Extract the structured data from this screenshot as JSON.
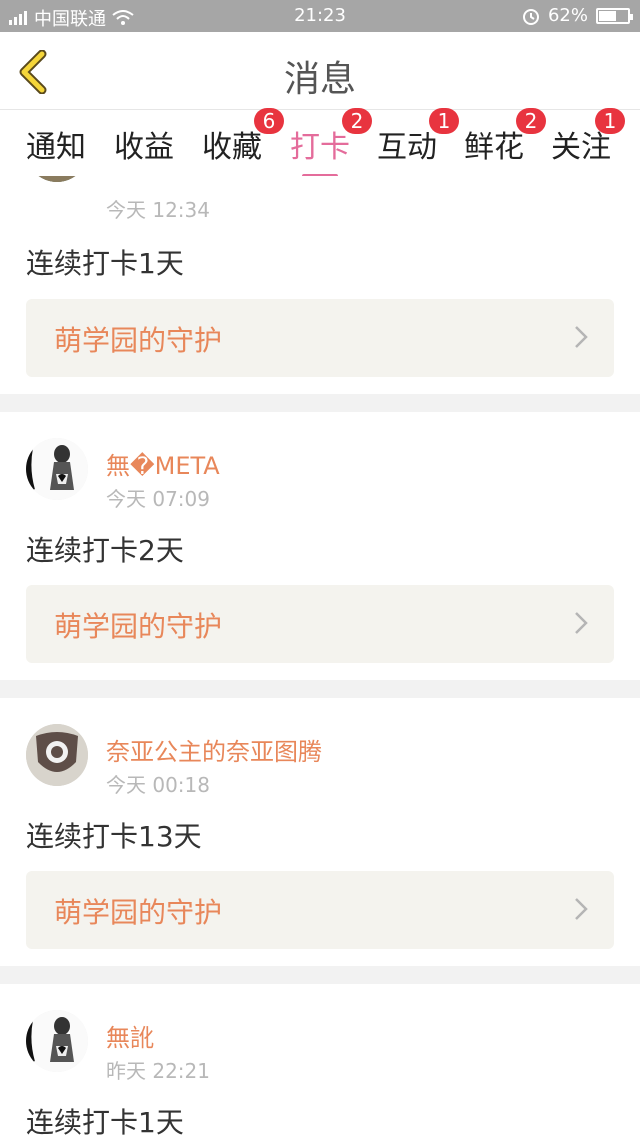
{
  "status_bar": {
    "signal": "4G",
    "carrier": "中国联通",
    "time": "21:23",
    "battery_percent": "62%",
    "battery_level": 0.62,
    "icons": [
      "signal-icon",
      "wifi-icon",
      "alarm-icon",
      "battery-icon"
    ]
  },
  "nav": {
    "title": "消息",
    "back_icon": "back-chevron-icon"
  },
  "colors": {
    "accent": "#e46c9b",
    "username": "#e8875a",
    "badge": "#e8343f",
    "link_bg": "#f4f3ee"
  },
  "tabs": [
    {
      "label": "通知",
      "badge": ""
    },
    {
      "label": "收益",
      "badge": ""
    },
    {
      "label": "收藏",
      "badge": "6"
    },
    {
      "label": "打卡",
      "badge": "2",
      "active": true
    },
    {
      "label": "互动",
      "badge": "1"
    },
    {
      "label": "鲜花",
      "badge": "2"
    },
    {
      "label": "关注",
      "badge": "1"
    }
  ],
  "items": [
    {
      "username": "",
      "time": "今天 12:34",
      "message": "连续打卡1天",
      "link": "萌学园的守护"
    },
    {
      "username": "無�META",
      "time": "今天 07:09",
      "message": "连续打卡2天",
      "link": "萌学园的守护"
    },
    {
      "username": "奈亚公主的奈亚图腾",
      "time": "今天 00:18",
      "message": "连续打卡13天",
      "link": "萌学园的守护"
    },
    {
      "username": "無訛",
      "time": "昨天 22:21",
      "message": "连续打卡1天",
      "link": ""
    }
  ]
}
